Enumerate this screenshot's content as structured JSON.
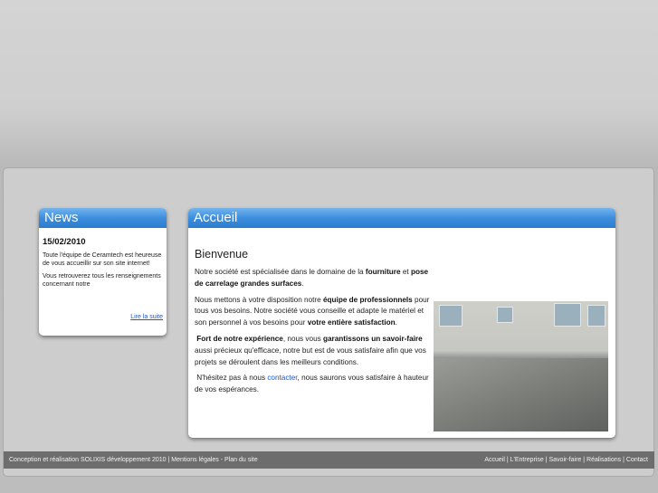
{
  "news": {
    "title": "News",
    "date": "15/02/2010",
    "paragraph1": "Toute l'équipe de Ceramtech est heureuse de vous accueillir sur son site internet!",
    "paragraph2": "Vous retrouverez tous les renseignements concernant notre",
    "link": "Lire la suite"
  },
  "accueil": {
    "title": "Accueil",
    "heading": "Bienvenue",
    "p1_a": "Notre société est spécialisée dans le domaine de la ",
    "p1_b": "fourniture",
    "p1_c": " et ",
    "p1_d": "pose de carrelage grandes surfaces",
    "p1_e": ".",
    "p2_a": "Nous mettons à votre disposition notre ",
    "p2_b": "équipe de professionnels",
    "p2_c": " pour tous vos besoins. Notre société vous conseille et adapte le matériel et son personnel à vos besoins pour ",
    "p2_d": "votre entière satisfaction",
    "p2_e": ".",
    "p3_a": "Fort de notre expérience",
    "p3_b": ", nous vous ",
    "p3_c": "garantissons un savoir-faire",
    "p3_d": " aussi précieux qu'efficace, notre but est de vous satisfaire afin que vos projets se déroulent dans les meilleurs conditions.",
    "p4_a": "N'hésitez pas à nous ",
    "p4_link": "contacter",
    "p4_b": ", nous saurons vous satisfaire à hauteur de vos espérances."
  },
  "footer": {
    "left": [
      "Conception et réalisation SOLIXIS développement 2010",
      " | ",
      "Mentions légales",
      " - ",
      "Plan du site"
    ],
    "right": [
      "Accueil",
      " | ",
      "L'Entreprise",
      " | ",
      "Savoir-faire",
      " | ",
      "Réalisations",
      " | ",
      "Contact"
    ]
  }
}
